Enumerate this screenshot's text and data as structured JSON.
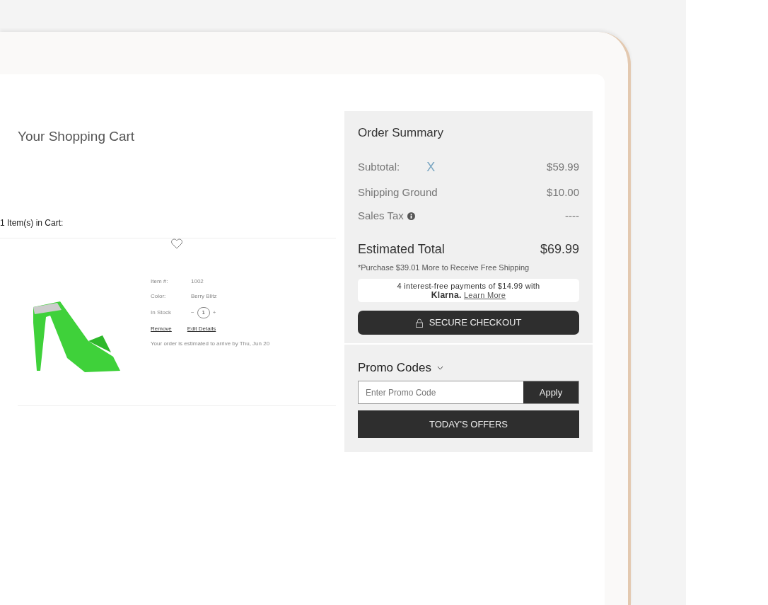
{
  "cart": {
    "title": "Your Shopping Cart",
    "item_count": "1 Item(s) in Cart:",
    "items": [
      {
        "item_label": "Item #:",
        "item_number": "1002",
        "color_label": "Color:",
        "color_value": "Berry Blitz",
        "stock": "In Stock",
        "minus": "−",
        "quantity": "1",
        "plus": "+",
        "remove": "Remove",
        "edit": "Edit Details",
        "delivery": "Your order is estimated to arrive by Thu, Jun 20"
      }
    ]
  },
  "summary": {
    "title": "Order Summary",
    "lines": [
      {
        "label": "Subtotal:",
        "marker": "X",
        "value": "$59.99",
        "kind": "marked"
      },
      {
        "label": "Shipping Ground",
        "value": "$10.00",
        "kind": "plain"
      },
      {
        "label": "Sales Tax",
        "value": "----",
        "kind": "info"
      }
    ],
    "total_label": "Estimated Total",
    "total_value": "$69.99",
    "note": "*Purchase $39.01 More to Receive Free Shipping",
    "klarna": {
      "text": "4 interest-free payments of $14.99 with",
      "brand": "Klarna.",
      "link": "Learn More"
    },
    "checkout": "SECURE CHECKOUT"
  },
  "promo": {
    "title": "Promo Codes",
    "placeholder": "Enter Promo Code",
    "apply": "Apply",
    "offers": "TODAY'S OFFERS"
  }
}
